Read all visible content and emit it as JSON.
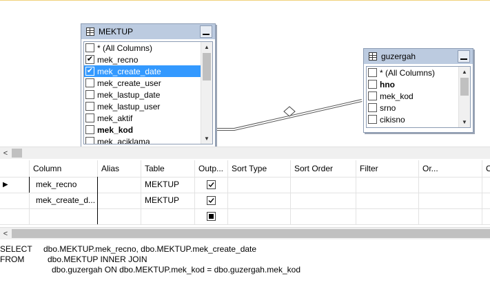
{
  "tables": {
    "mektup": {
      "name": "MEKTUP",
      "columns": [
        {
          "label": "* (All Columns)",
          "checked": false,
          "bold": false,
          "selected": false
        },
        {
          "label": "mek_recno",
          "checked": true,
          "bold": false,
          "selected": false
        },
        {
          "label": "mek_create_date",
          "checked": true,
          "bold": false,
          "selected": true
        },
        {
          "label": "mek_create_user",
          "checked": false,
          "bold": false,
          "selected": false
        },
        {
          "label": "mek_lastup_date",
          "checked": false,
          "bold": false,
          "selected": false
        },
        {
          "label": "mek_lastup_user",
          "checked": false,
          "bold": false,
          "selected": false
        },
        {
          "label": "mek_aktif",
          "checked": false,
          "bold": false,
          "selected": false
        },
        {
          "label": "mek_kod",
          "checked": false,
          "bold": true,
          "selected": false
        },
        {
          "label": "mek_aciklama",
          "checked": false,
          "bold": false,
          "selected": false
        }
      ]
    },
    "guzergah": {
      "name": "guzergah",
      "columns": [
        {
          "label": "* (All Columns)",
          "checked": false,
          "bold": false,
          "selected": false
        },
        {
          "label": "hno",
          "checked": false,
          "bold": true,
          "selected": false
        },
        {
          "label": "mek_kod",
          "checked": false,
          "bold": false,
          "selected": false
        },
        {
          "label": "srno",
          "checked": false,
          "bold": false,
          "selected": false
        },
        {
          "label": "cikisno",
          "checked": false,
          "bold": false,
          "selected": false
        }
      ]
    }
  },
  "grid": {
    "headers": [
      "Column",
      "Alias",
      "Table",
      "Outp...",
      "Sort Type",
      "Sort Order",
      "Filter",
      "Or...",
      "Or..."
    ],
    "rows": [
      {
        "column": "mek_recno",
        "alias": "",
        "table": "MEKTUP",
        "output": "checked",
        "current": true
      },
      {
        "column": "mek_create_d...",
        "alias": "",
        "table": "MEKTUP",
        "output": "checked",
        "current": false
      },
      {
        "column": "",
        "alias": "",
        "table": "",
        "output": "indeterminate",
        "current": false
      }
    ]
  },
  "sql": {
    "select_kw": "SELECT",
    "select_cols": "dbo.MEKTUP.mek_recno, dbo.MEKTUP.mek_create_date",
    "from_kw": "FROM",
    "from_line1": "dbo.MEKTUP INNER JOIN",
    "from_line2": "dbo.guzergah ON dbo.MEKTUP.mek_kod = dbo.guzergah.mek_kod"
  }
}
